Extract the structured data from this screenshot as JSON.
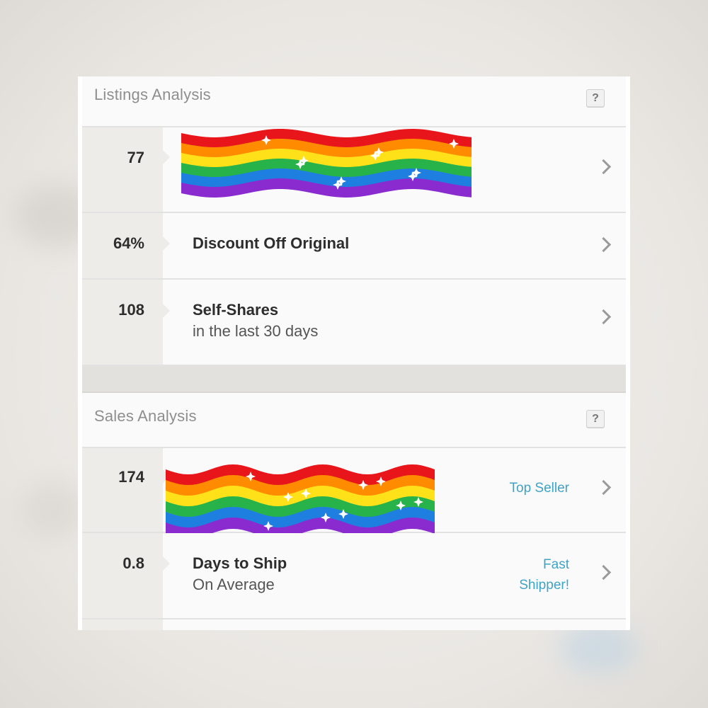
{
  "listings": {
    "title": "Listings Analysis",
    "help": "?",
    "rows": [
      {
        "value": "77",
        "label": "",
        "sublabel": ""
      },
      {
        "value": "64%",
        "label": "Discount Off Original",
        "sublabel": ""
      },
      {
        "value": "108",
        "label": "Self-Shares",
        "sublabel": "in the last 30 days"
      }
    ]
  },
  "sales": {
    "title": "Sales Analysis",
    "help": "?",
    "rows": [
      {
        "value": "174",
        "label": "",
        "sublabel": "",
        "badge": "Top Seller"
      },
      {
        "value": "0.8",
        "label": "Days to Ship",
        "sublabel": "On Average",
        "badge_line1": "Fast",
        "badge_line2": "Shipper!"
      }
    ]
  },
  "colors": {
    "accent": "#3fa3c6",
    "value_column": "#eeece8",
    "divider": "#e3e1dd",
    "rainbow": [
      "#e8151b",
      "#ff8c00",
      "#ffe11a",
      "#27b34a",
      "#1e7fe0",
      "#8a2bd0"
    ]
  },
  "icons": {
    "help": "question-mark-icon",
    "row_arrow": "chevron-right-icon",
    "redaction": "rainbow-flag-sticker"
  }
}
